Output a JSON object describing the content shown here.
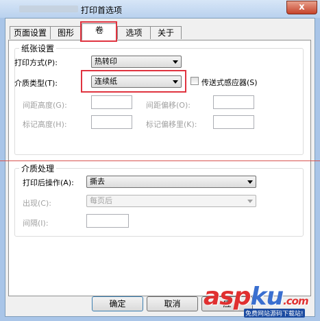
{
  "window": {
    "title": "打印首选项",
    "close_label": "x"
  },
  "tabs": [
    {
      "label": "页面设置",
      "active": false
    },
    {
      "label": "图形",
      "active": false
    },
    {
      "label": "卷",
      "active": true
    },
    {
      "label": "选项",
      "active": false
    },
    {
      "label": "关于",
      "active": false
    }
  ],
  "paper": {
    "legend": "纸张设置",
    "print_method_label": "打印方式(P):",
    "print_method_value": "热转印",
    "media_type_label": "介质类型(T):",
    "media_type_value": "连续纸",
    "sensor_label": "传送式感应器(S)",
    "gap_height_label": "间距高度(G):",
    "gap_offset_label": "间距偏移(O):",
    "mark_height_label": "标记高度(H):",
    "mark_offset_label": "标记偏移里(K):"
  },
  "media": {
    "legend": "介质处理",
    "after_print_label": "打印后操作(A):",
    "after_print_value": "撕去",
    "occurrence_label": "出现(C):",
    "occurrence_value": "每页后",
    "interval_label": "间隔(I):"
  },
  "buttons": {
    "ok": "确定",
    "cancel": "取消",
    "apply": "应"
  },
  "watermark": {
    "main": "asp",
    "accent": "ku",
    "suffix": ".com",
    "sub": "免费网站源码下载站!"
  }
}
